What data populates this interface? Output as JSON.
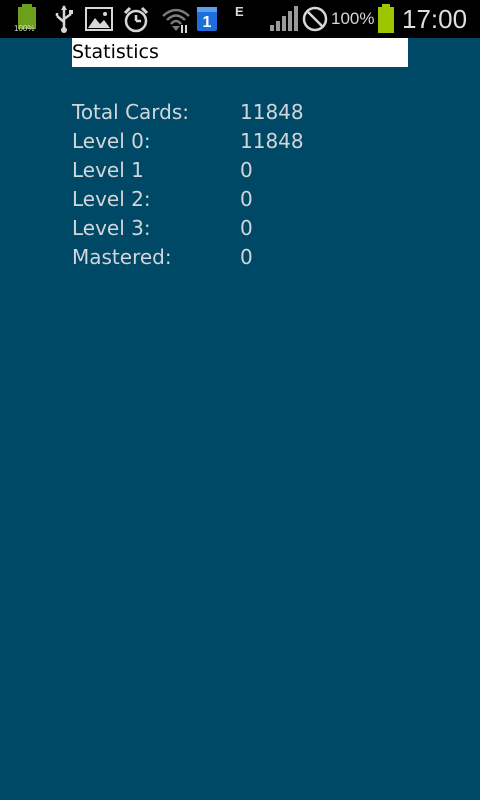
{
  "status_bar": {
    "icons": [
      "battery-full-icon",
      "usb-icon",
      "gallery-icon",
      "alarm-icon",
      "wifi-icon",
      "calendar-icon",
      "signal-icon",
      "do-not-disturb-icon",
      "battery-charging-icon"
    ],
    "small_battery_label": "100%",
    "network_type": "E",
    "battery_percent": "100%",
    "calendar_number": "1",
    "time": "17:00"
  },
  "screen": {
    "title": "Statistics",
    "stats": [
      {
        "label": "Total Cards:",
        "value": "11848"
      },
      {
        "label": "Level 0:",
        "value": "11848"
      },
      {
        "label": "Level 1",
        "value": "0"
      },
      {
        "label": "Level 2:",
        "value": "0"
      },
      {
        "label": "Level 3:",
        "value": "0"
      },
      {
        "label": "Mastered:",
        "value": "0"
      }
    ]
  },
  "colors": {
    "background": "#004966",
    "title_bg": "#ffffff",
    "text": "#d0d6d9",
    "battery_green": "#9cc700"
  }
}
